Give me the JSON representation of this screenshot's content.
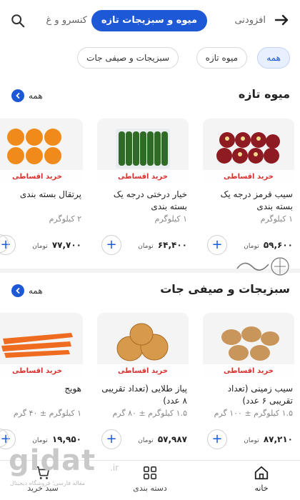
{
  "header": {
    "categories": [
      "افزودنی",
      "میوه و سبزیجات تازه",
      "کنسرو و غ"
    ]
  },
  "filters": [
    "همه",
    "میوه تازه",
    "سبزیجات و صیفی جات"
  ],
  "sections": [
    {
      "title": "میوه تازه",
      "see_all": "همه",
      "products": [
        {
          "name": "سیب قرمز درجه یک بسته بندی",
          "badge": "خرید اقساطی",
          "weight": "۱ کیلوگرم",
          "price": "۵۹,۶۰۰",
          "currency": "تومان"
        },
        {
          "name": "خیار درختی درجه یک بسته بندی",
          "badge": "خرید اقساطی",
          "weight": "۱ کیلوگرم",
          "price": "۶۴,۴۰۰",
          "currency": "تومان"
        },
        {
          "name": "پرتقال بسته بندی",
          "badge": "خرید اقساطی",
          "weight": "۲ کیلوگرم",
          "price": "۷۷,۷۰۰",
          "currency": "تومان"
        }
      ]
    },
    {
      "title": "سبزیجات و صیفی جات",
      "see_all": "همه",
      "products": [
        {
          "name": "سیب زمینی (تعداد تقریبی ۶ عدد)",
          "badge": "خرید اقساطی",
          "weight": "۱.۵ کیلوگرم ± ۱۰۰ گرم",
          "price": "۸۷,۲۱۰",
          "currency": "تومان"
        },
        {
          "name": "پیاز طلایی (تعداد تقریبی ۸ عدد)",
          "badge": "خرید اقساطی",
          "weight": "۱.۵ کیلوگرم ± ۸۰ گرم",
          "price": "۵۷,۹۸۷",
          "currency": "تومان"
        },
        {
          "name": "هویج",
          "badge": "خرید اقساطی",
          "weight": "۱ کیلوگرم ± ۴۰ گرم",
          "price": "۱۹,۹۵۰",
          "currency": "تومان"
        }
      ]
    }
  ],
  "bottom_nav": [
    "خانه",
    "دسته بندی",
    "سبد خرید"
  ],
  "watermark": {
    "logo": "gidat",
    "tld": ".ir",
    "subtitle": "مقاله فارسی؛ فروشگاه دیجیتال"
  },
  "colors": {
    "accent": "#1d59d6",
    "badge_text": "#d8302d"
  }
}
